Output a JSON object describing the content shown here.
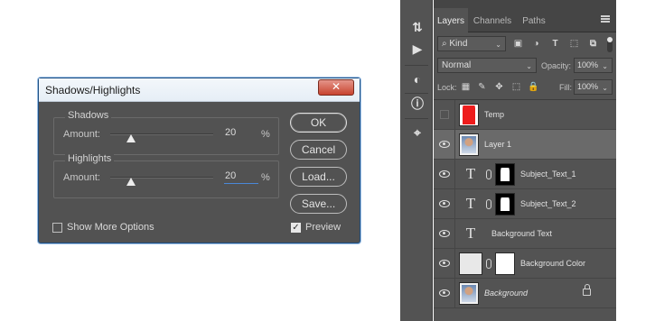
{
  "dialog": {
    "title": "Shadows/Highlights",
    "close_glyph": "✕",
    "shadows": {
      "title": "Shadows",
      "amount_label": "Amount:",
      "value": "20",
      "unit": "%",
      "slider_fraction": 0.2
    },
    "highlights": {
      "title": "Highlights",
      "amount_label": "Amount:",
      "value": "20",
      "unit": "%",
      "slider_fraction": 0.2
    },
    "buttons": {
      "ok": "OK",
      "cancel": "Cancel",
      "load": "Load...",
      "save": "Save..."
    },
    "show_more_options": {
      "label": "Show More Options",
      "checked": false
    },
    "preview": {
      "label": "Preview",
      "checked": true,
      "check_glyph": "✓"
    }
  },
  "toolbar": {
    "icons": [
      {
        "name": "history-icon",
        "glyph": "⇅"
      },
      {
        "name": "actions-play-icon",
        "glyph": "▶"
      },
      {
        "name": "adjustments-icon",
        "glyph": "◐"
      },
      {
        "name": "info-icon",
        "glyph": "ⓘ"
      },
      {
        "name": "clone-source-icon",
        "glyph": "⌖"
      }
    ]
  },
  "layers_panel": {
    "tabs": [
      "Layers",
      "Channels",
      "Paths"
    ],
    "active_tab": "Layers",
    "filter": {
      "kind_label": "Kind",
      "dropdown_arrow": "⌄"
    },
    "filter_icons": [
      "image-filter-icon",
      "adjustment-filter-icon",
      "type-filter-icon",
      "shape-filter-icon",
      "smart-object-filter-icon"
    ],
    "filter_glyphs": [
      "▣",
      "◑",
      "T",
      "⬚",
      "⧉"
    ],
    "blend_mode": "Normal",
    "opacity_label": "Opacity:",
    "opacity_value": "100%",
    "lock_label": "Lock:",
    "lock_glyphs": [
      "▦",
      "✎",
      "✥",
      "⬚",
      "🔒"
    ],
    "fill_label": "Fill:",
    "fill_value": "100%",
    "layers": [
      {
        "name": "Temp",
        "visible": false,
        "type": "pixel-red",
        "selected": false,
        "italic": false
      },
      {
        "name": "Layer 1",
        "visible": true,
        "type": "photo",
        "selected": true,
        "italic": false
      },
      {
        "name": "Subject_Text_1",
        "visible": true,
        "type": "text-masked",
        "selected": false,
        "italic": false
      },
      {
        "name": "Subject_Text_2",
        "visible": true,
        "type": "text-masked",
        "selected": false,
        "italic": false
      },
      {
        "name": "Background Text",
        "visible": true,
        "type": "text",
        "selected": false,
        "italic": false
      },
      {
        "name": "Background Color",
        "visible": true,
        "type": "fill-masked",
        "selected": false,
        "italic": false
      },
      {
        "name": "Background",
        "visible": true,
        "type": "photo-locked",
        "selected": false,
        "italic": true
      }
    ]
  }
}
